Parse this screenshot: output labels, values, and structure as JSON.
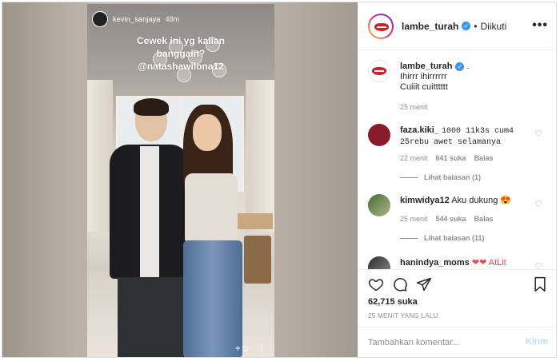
{
  "story": {
    "username": "kevin_sanjaya",
    "time": "48m",
    "caption_line1": "Cewek ini yg kalian",
    "caption_line2": "banggain?",
    "caption_line3": "@natashawilona12"
  },
  "header": {
    "username": "lambe_turah",
    "separator": "•",
    "follow_status": "Diikuti",
    "more_icon": "more-options-icon"
  },
  "caption": {
    "username": "lambe_turah",
    "trailing": ".",
    "line1": "Ihirrr ihirrrrrr",
    "line2": "Cuiiit cuitttttt",
    "time": "25 menit"
  },
  "comments": [
    {
      "username": "faza.kiki_",
      "text": "1000 11k3s cum4 25rebu awet selamanya",
      "time": "22 menit",
      "likes": "641 suka",
      "reply": "Balas",
      "view_replies": "Lihat balasan (1)"
    },
    {
      "username": "kimwidya12",
      "text": "Aku dukung",
      "emoji": "😍",
      "time": "25 menit",
      "likes": "544 suka",
      "reply": "Balas",
      "view_replies": "Lihat balasan (11)"
    },
    {
      "username": "hanindya_moms",
      "text": "❤❤ AtLit"
    }
  ],
  "actions": {
    "likes": "62,715 suka",
    "posted": "25 MENIT YANG LALU"
  },
  "add_comment": {
    "placeholder": "Tambahkan komentar...",
    "post_label": "Kirim"
  },
  "colors": {
    "verified": "#3897f0",
    "link_disabled": "#b2dffc",
    "heart_red": "#ed4956"
  }
}
